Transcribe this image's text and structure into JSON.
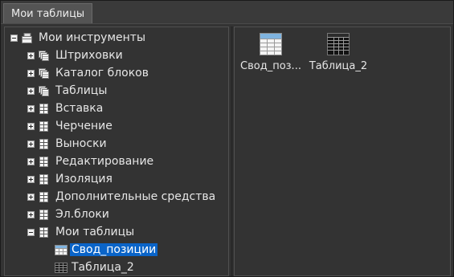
{
  "window": {
    "tab_label": "Мои таблицы"
  },
  "tree": {
    "root_label": "Мои инструменты",
    "items": [
      {
        "label": "Штриховки",
        "icon": "stacked-sheets-icon"
      },
      {
        "label": "Каталог блоков",
        "icon": "stacked-sheets-icon"
      },
      {
        "label": "Таблицы",
        "icon": "stacked-sheets-icon"
      },
      {
        "label": "Вставка",
        "icon": "grid-sheet-icon"
      },
      {
        "label": "Черчение",
        "icon": "grid-sheet-icon"
      },
      {
        "label": "Выноски",
        "icon": "grid-sheet-icon"
      },
      {
        "label": "Редактирование",
        "icon": "grid-sheet-icon"
      },
      {
        "label": "Изоляция",
        "icon": "grid-sheet-icon"
      },
      {
        "label": "Дополнительные средства",
        "icon": "grid-sheet-icon"
      },
      {
        "label": "Эл.блоки",
        "icon": "grid-sheet-icon"
      },
      {
        "label": "Мои таблицы",
        "icon": "grid-sheet-icon"
      }
    ],
    "children": [
      {
        "label": "Свод_позиции",
        "icon": "table-light-icon",
        "selected": true
      },
      {
        "label": "Таблица_2",
        "icon": "table-dark-icon",
        "selected": false
      }
    ]
  },
  "content": {
    "tiles": [
      {
        "label": "Свод_поз...",
        "icon": "table-light-icon"
      },
      {
        "label": "Таблица_2",
        "icon": "table-dark-icon"
      }
    ]
  },
  "colors": {
    "background": "#333333",
    "selection": "#0a64c8",
    "text": "#e6e6e6"
  }
}
